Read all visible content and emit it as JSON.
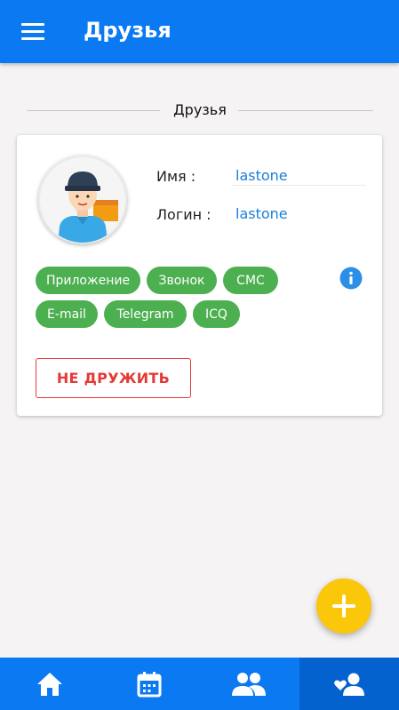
{
  "appbar": {
    "title": "Друзья",
    "menu_icon": "hamburger-menu-icon",
    "color": "#0a79f2"
  },
  "section": {
    "title": "Друзья"
  },
  "friend": {
    "avatar_icon": "delivery-man-avatar",
    "name_label": "Имя :",
    "name_value": "lastone",
    "login_label": "Логин :",
    "login_value": "lastone",
    "chips": [
      "Приложение",
      "Звонок",
      "СМС",
      "E-mail",
      "Telegram",
      "ICQ"
    ],
    "chip_color": "#4caf50",
    "info_icon": "info-icon",
    "unfriend_label": "НЕ ДРУЖИТЬ",
    "unfriend_color": "#e53935"
  },
  "fab": {
    "icon": "plus-icon",
    "color": "#fbc70a"
  },
  "bottom_nav": {
    "items": [
      {
        "icon": "home-icon"
      },
      {
        "icon": "calendar-icon"
      },
      {
        "icon": "people-icon"
      },
      {
        "icon": "friend-heart-icon",
        "active": true
      }
    ]
  }
}
